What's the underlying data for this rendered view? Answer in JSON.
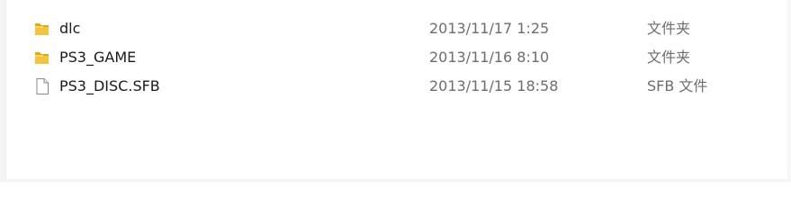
{
  "files": [
    {
      "name": "dlc",
      "date": "2013/11/17 1:25",
      "type": "文件夹",
      "icon": "folder-icon"
    },
    {
      "name": "PS3_GAME",
      "date": "2013/11/16 8:10",
      "type": "文件夹",
      "icon": "folder-icon"
    },
    {
      "name": "PS3_DISC.SFB",
      "date": "2013/11/15 18:58",
      "type": "SFB 文件",
      "icon": "file-icon"
    }
  ],
  "colors": {
    "folder_yellow": "#f5c342",
    "folder_dark": "#e0a820",
    "text_primary": "#1a1a1a",
    "text_secondary": "#6d6d6d"
  }
}
